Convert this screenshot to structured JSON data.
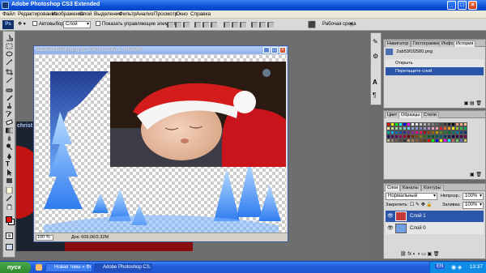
{
  "app": {
    "title": "Adobe Photoshop CS3 Extended"
  },
  "menu": [
    "Файл",
    "Редактирование",
    "Изображение",
    "Слой",
    "Выделение",
    "Фильтр",
    "Анализ",
    "Просмотр",
    "Окно",
    "Справка"
  ],
  "options": {
    "ps_logo": "Ps",
    "autoselect_label": "Автовыбор:",
    "autoselect_value": "Слой",
    "transform_label": "Показать управляющие элементы",
    "workspace_label": "Рабочая среда"
  },
  "document": {
    "title": "2ab53f1f2580.png @ 100% (Слой 1, RGB/8)",
    "zoom": "100 %",
    "info": "Док: 609,0К/2,32М",
    "bg_label": "christ"
  },
  "navigator_panel": {
    "tabs": [
      "Навигатор",
      "Гистограмма",
      "Инфо",
      "История"
    ],
    "active_tab": 3,
    "items": [
      "2ab53f1f2580.png",
      "Открыть",
      "Перетащите слой"
    ]
  },
  "swatches_panel": {
    "tabs": [
      "Цвет",
      "Образцы",
      "Стили"
    ],
    "active_tab": 1
  },
  "layers_panel": {
    "tabs": [
      "Слои",
      "Каналы",
      "Контуры"
    ],
    "blend_mode": "Нормальный",
    "opacity_label": "Непрозр.:",
    "opacity_value": "100%",
    "lock_label": "Закрепить:",
    "fill_label": "Заливка:",
    "fill_value": "100%",
    "layers": [
      {
        "name": "Слой 1",
        "selected": true
      },
      {
        "name": "Слой 0",
        "selected": false
      }
    ]
  },
  "taskbar": {
    "start": "пуск",
    "items": [
      "Новая тема « Форум...",
      "Adobe Photoshop CS..."
    ],
    "active_index": 1,
    "lang": "EN",
    "clock": "13:37"
  },
  "colors": {
    "foreground": "#e21010",
    "background": "#ffffff",
    "selection": "#2a55a8"
  }
}
